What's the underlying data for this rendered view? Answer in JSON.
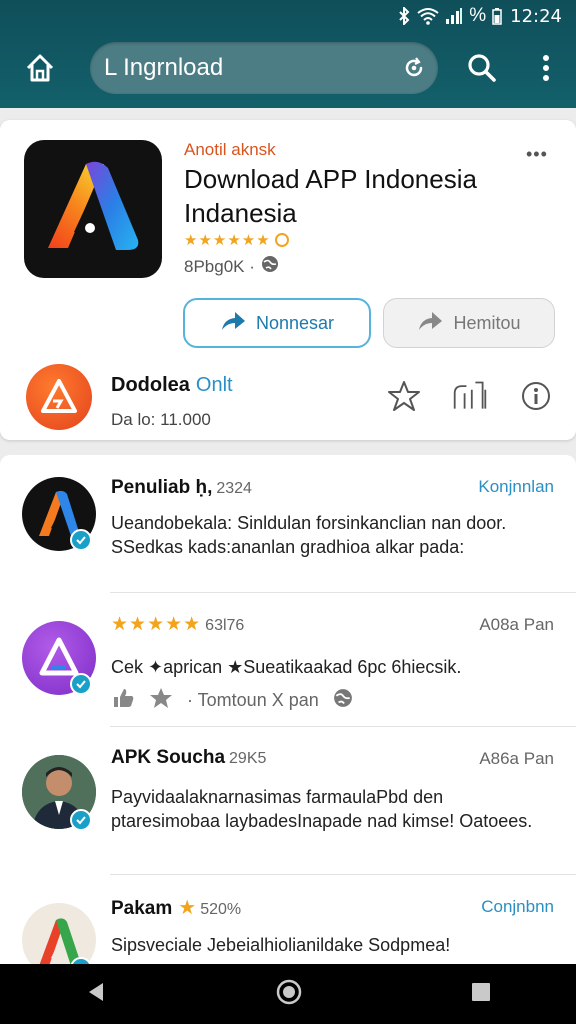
{
  "status": {
    "time": "12:24",
    "percent": "%"
  },
  "header": {
    "search_value": "L Ingrnload"
  },
  "app": {
    "publisher": "Anotil aknsk",
    "title": "Download APP Indonesia Indanesia",
    "stars": "★★★★★★",
    "meta": "8Pbg0K ·",
    "install_label": "Nonnesar",
    "share_label": "Hemitou",
    "sub_title": "Dodolea",
    "sub_title_accent": "Onlt",
    "sub_count": "Da lo: 11.000"
  },
  "reviews": [
    {
      "name": "Penuliab ḥ,",
      "pct": "2324",
      "right": "Konjnnlan",
      "text": "Ueandobekala: Sinldulan forsinkanclian nan door. SSedkas kads:ananlan gradhioa alkar pada:"
    },
    {
      "stars": "★★★★★",
      "pct": "63l76",
      "right": "A08a Pan",
      "text": "Cek ✦aprican ★Sueatikaakad 6pc 6hiecsik.",
      "actions_text": "· Tomtoun X pan"
    },
    {
      "name": "APK Soucha",
      "pct": "29K5",
      "right": "A86a Pan",
      "text": "Payvidaalaknarnasimas farmaulaPbd den ptaresimobaa laybadesInapade nad kimse! Oatoees."
    },
    {
      "name": "Pakam",
      "pct": "520%",
      "right": "Conjnbnn",
      "text": "Sipsveciale Jebeialhiolianildake Sodpmea!"
    }
  ]
}
